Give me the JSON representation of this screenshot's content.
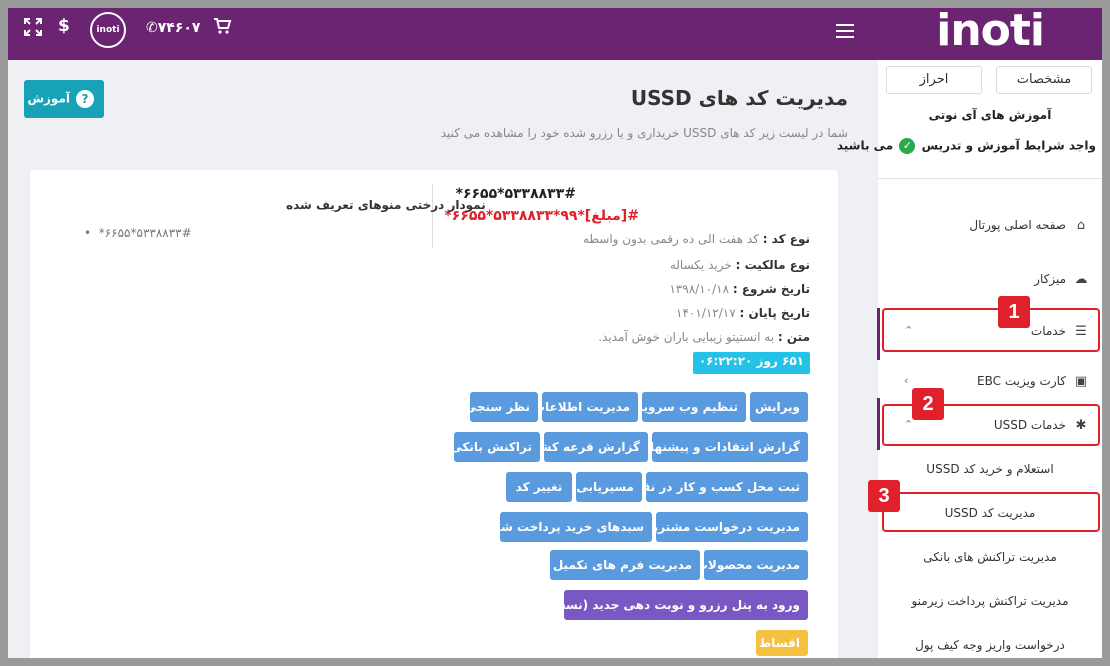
{
  "topbar": {
    "logo": "inoti",
    "circle_logo": "inoti",
    "phone": "۷۴۶۰۷",
    "dollar": "$"
  },
  "sidebar": {
    "tabs": {
      "spec": "مشخصات",
      "auth": "احراز"
    },
    "title": "آموزش های آی نوتی",
    "condition_before": "واجد شرایط آموزش و تدریس",
    "condition_after": "می باشید",
    "menu": {
      "portal": "صفحه اصلی پورتال",
      "mizkar": "میزکار",
      "services": "خدمات",
      "ebc": "کارت ویزیت EBC",
      "ussd_services": "خدمات USSD"
    },
    "sub": {
      "inquiry": "استعلام و خرید کد USSD",
      "manage": "مدیریت کد USSD",
      "bank": "مدیریت تراکنش های بانکی",
      "zirmano": "مدیریت تراکنش پرداخت زیرمنو",
      "wallet": "درخواست واریز وجه کیف پول"
    },
    "badges": [
      "1",
      "2",
      "3"
    ]
  },
  "main": {
    "title": "مدیریت کد های USSD",
    "subtitle": "شما در لیست زیر کد های USSD خریداری و یا رزرو شده خود را مشاهده می کنید",
    "help": "آموزش"
  },
  "card": {
    "code": "*۶۶۵۵*۵۳۳۸۸۳۳#",
    "code_amount": "*۶۶۵۵*۵۳۳۸۸۳۳*۹۹*[مبلغ]#",
    "rows": [
      {
        "label": "نوع کد :",
        "value": "کد هفت الی ده رقمی بدون واسطه"
      },
      {
        "label": "نوع مالکیت :",
        "value": "خرید یکساله"
      },
      {
        "label": "تاریخ شروع :",
        "value": "۱۳۹۸/۱۰/۱۸"
      },
      {
        "label": "تاریخ پایان :",
        "value": "۱۴۰۱/۱۲/۱۷"
      },
      {
        "label": "متن :",
        "value": "به انستیتو زیبایی باران خوش آمدید."
      }
    ],
    "timer": "۶۵۱ روز ۰۶:۲۲:۲۰",
    "tree_title": "نمودار درختی منوهای تعریف شده",
    "tree_item": "*۶۶۵۵*۵۳۳۸۸۳۳#"
  },
  "buttons": {
    "edit": "ویرایش",
    "webservice": "تنظیم وب سرویس",
    "info": "مدیریت اطلاعات",
    "survey": "نظر سنجی",
    "critique": "گزارش انتقادات و پیشنهادات",
    "lottery": "گزارش قرعه کشی",
    "banktx": "تراکنش بانکی",
    "map": "ثبت محل کسب و کار در نقشه",
    "route": "مسیریابی",
    "changecode": "تغییر کد",
    "customer": "مدیریت درخواست مشتریان",
    "carts": "سبدهای خرید پرداخت شده",
    "products": "مدیریت محصولات",
    "forms": "مدیریت فرم های تکمیل شده",
    "reserve": "ورود به پنل رزرو و نوبت دهی جدید (نسخه بتا)",
    "installments": "اقساط"
  }
}
